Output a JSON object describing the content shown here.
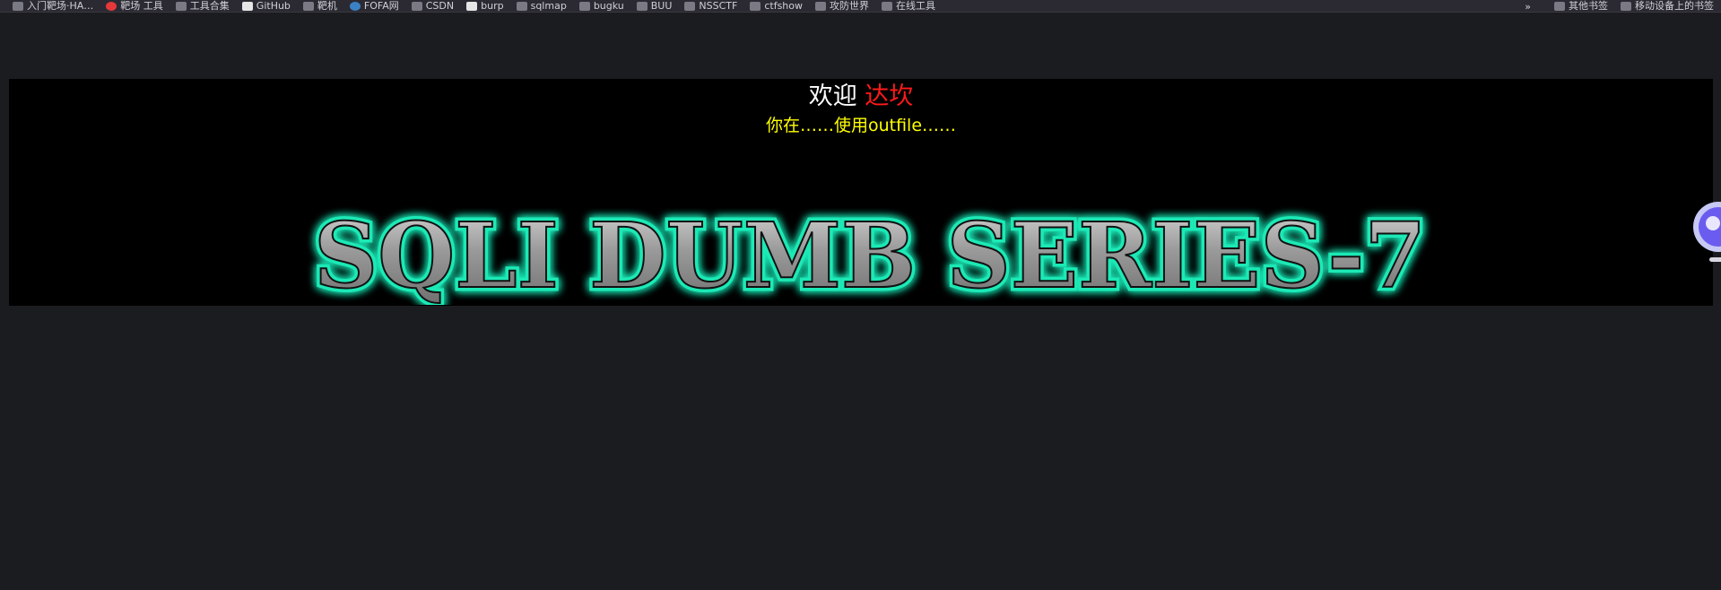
{
  "bookmarks": [
    {
      "icon": "folder-icon",
      "label": "入门靶场·HA…"
    },
    {
      "icon": "red-circle-icon",
      "label": "靶场 工具"
    },
    {
      "icon": "folder-icon",
      "label": "工具合集"
    },
    {
      "icon": "globe-icon",
      "label": "GitHub"
    },
    {
      "icon": "folder-icon",
      "label": "靶机"
    },
    {
      "icon": "blue-circle-icon",
      "label": "FOFA网"
    },
    {
      "icon": "folder-icon",
      "label": "CSDN"
    },
    {
      "icon": "white-square-icon",
      "label": "burp"
    },
    {
      "icon": "folder-icon",
      "label": "sqlmap"
    },
    {
      "icon": "folder-icon",
      "label": "bugku"
    },
    {
      "icon": "folder-icon",
      "label": "BUU"
    },
    {
      "icon": "folder-icon",
      "label": "NSSCTF"
    },
    {
      "icon": "folder-icon",
      "label": "ctfshow"
    },
    {
      "icon": "folder-icon",
      "label": "攻防世界"
    },
    {
      "icon": "folder-icon",
      "label": "在线工具"
    }
  ],
  "bookmarks_overflow": "»",
  "bookmarks_right": [
    {
      "icon": "folder-icon",
      "label": "其他书签"
    },
    {
      "icon": "folder-icon",
      "label": "移动设备上的书签"
    }
  ],
  "page": {
    "welcome_prefix": "欢迎",
    "welcome_name": "达坎",
    "subline": "你在……使用outfile……",
    "title_art": "SQLI DUMB SERIES-7"
  },
  "colors": {
    "background": "#1b1c1f",
    "banner": "#000000",
    "welcome_name": "#ff1a1a",
    "subline": "#ffff00",
    "title_glow": "#1de9b6"
  }
}
